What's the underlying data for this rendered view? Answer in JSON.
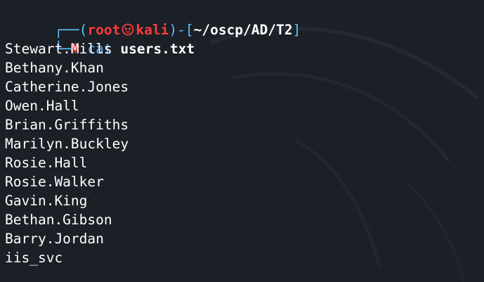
{
  "prompt": {
    "corner_top": "┌──(",
    "user": "root",
    "host": "kali",
    "mid": ")-[",
    "cwd": "~/oscp/AD/T2",
    "end": "]",
    "corner_bottom": "└─",
    "symbol": "#",
    "command": "cat",
    "argument": "users.txt"
  },
  "output": [
    "Stewart.Mills",
    "Bethany.Khan",
    "Catherine.Jones",
    "Owen.Hall",
    "Brian.Griffiths",
    "Marilyn.Buckley",
    "Rosie.Hall",
    "Rosie.Walker",
    "Gavin.King",
    "Bethan.Gibson",
    "Barry.Jordan",
    "iis_svc"
  ],
  "colors": {
    "background": "#1b1f26",
    "prompt_blue": "#5fc1ff",
    "prompt_red": "#ff3b3b",
    "text": "#ffffff"
  },
  "icons": {
    "separator": "kali-skull-icon"
  }
}
